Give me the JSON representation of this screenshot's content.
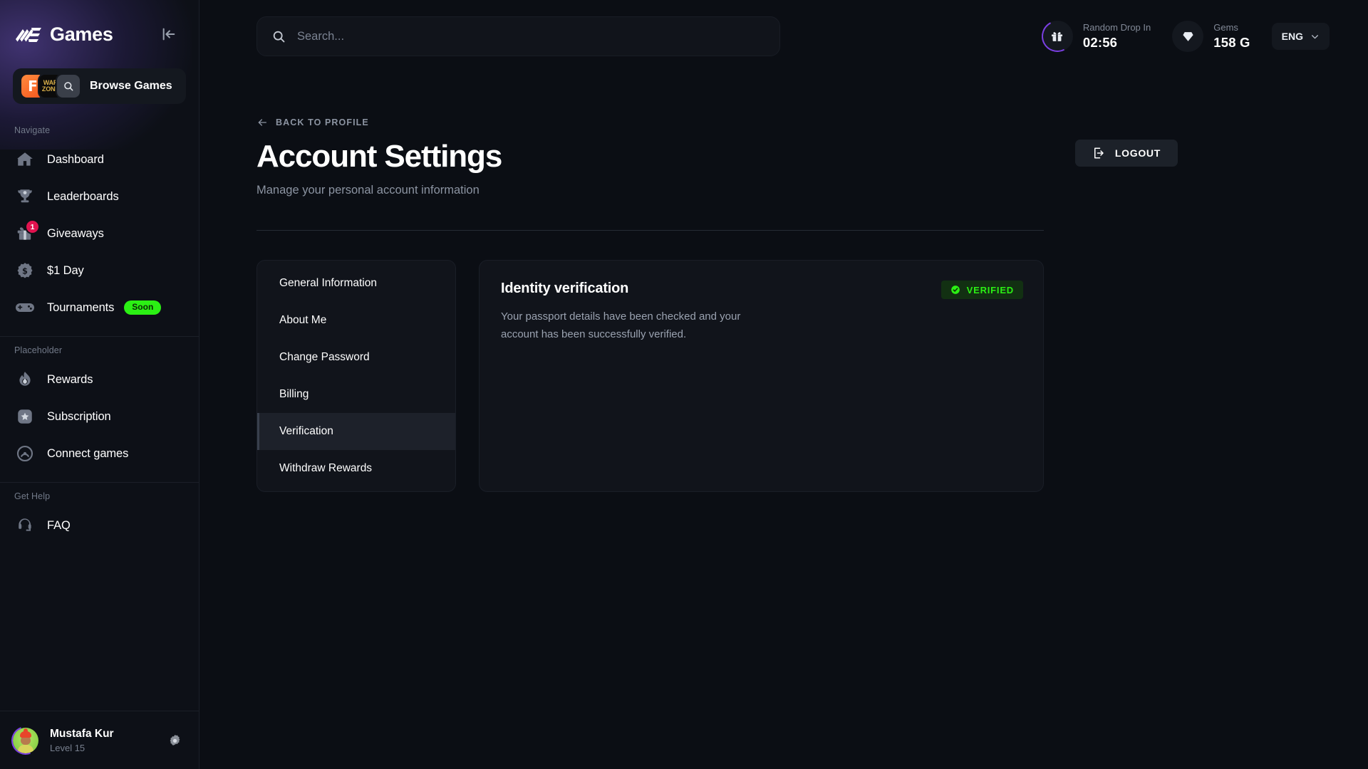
{
  "brand": {
    "name": "Games",
    "logo_icon": "ms-games-logo"
  },
  "sidebar": {
    "collapse_icon": "collapse-left-icon",
    "browse": {
      "label": "Browse Games",
      "tiles": [
        {
          "icon": "fortnite-game-icon",
          "text": "F"
        },
        {
          "icon": "warzone-game-icon",
          "line1": "WAR",
          "line2": "ZONE"
        },
        {
          "icon": "search-icon"
        }
      ]
    },
    "groups": [
      {
        "label": "Navigate",
        "items": [
          {
            "label": "Dashboard",
            "icon": "home-icon"
          },
          {
            "label": "Leaderboards",
            "icon": "trophy-icon"
          },
          {
            "label": "Giveaways",
            "icon": "gift-icon",
            "badge": "1"
          },
          {
            "label": "$1 Day",
            "icon": "dollar-badge-icon"
          },
          {
            "label": "Tournaments",
            "icon": "gamepad-icon",
            "pill": "Soon"
          }
        ]
      },
      {
        "label": "Placeholder",
        "items": [
          {
            "label": "Rewards",
            "icon": "flame-icon"
          },
          {
            "label": "Subscription",
            "icon": "star-square-icon"
          },
          {
            "label": "Connect games",
            "icon": "signal-target-icon"
          }
        ]
      },
      {
        "label": "Get Help",
        "items": [
          {
            "label": "FAQ",
            "icon": "headset-icon"
          }
        ]
      }
    ],
    "user": {
      "name": "Mustafa Kur",
      "level": "Level 15",
      "avatar_icon": "user-avatar",
      "settings_icon": "gear-icon"
    }
  },
  "topbar": {
    "search": {
      "placeholder": "Search...",
      "value": "",
      "icon": "search-icon"
    },
    "stats": [
      {
        "icon": "gift-icon",
        "label": "Random Drop In",
        "value": "02:56"
      },
      {
        "icon": "gem-icon",
        "label": "Gems",
        "value": "158 G"
      }
    ],
    "language": {
      "value": "ENG",
      "icon": "chevron-down-icon"
    }
  },
  "page": {
    "back_label": "BACK TO PROFILE",
    "back_icon": "arrow-left-icon",
    "title": "Account Settings",
    "subtitle": "Manage your personal account information",
    "logout_label": "LOGOUT",
    "logout_icon": "logout-icon"
  },
  "settings_tabs": [
    {
      "label": "General Information",
      "active": false
    },
    {
      "label": "About Me",
      "active": false
    },
    {
      "label": "Change Password",
      "active": false
    },
    {
      "label": "Billing",
      "active": false
    },
    {
      "label": "Verification",
      "active": true
    },
    {
      "label": "Withdraw Rewards",
      "active": false
    }
  ],
  "verification": {
    "title": "Identity verification",
    "description": "Your passport details have been checked and your account has been successfully verified.",
    "badge_label": "VERIFIED",
    "badge_icon": "check-circle-icon"
  },
  "colors": {
    "background": "#0b0e14",
    "sidebar": "#0d1017",
    "card": "#11141b",
    "accent_green": "#2bf014",
    "accent_purple": "#7b3fe4",
    "badge_red": "#e0134f",
    "text_muted": "#8c94a2"
  }
}
